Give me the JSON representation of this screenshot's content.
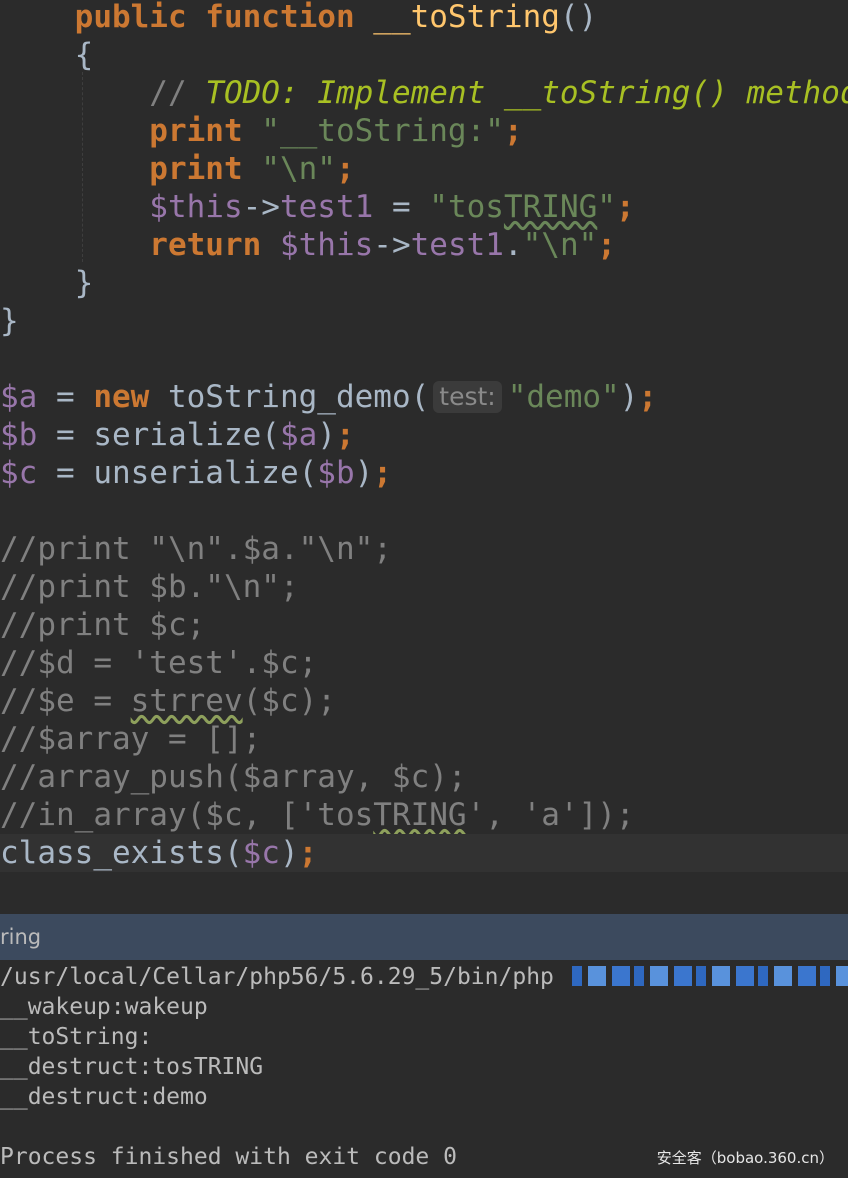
{
  "editor": {
    "lines": [
      {
        "segs": [
          [
            "kw",
            "    public function "
          ],
          [
            "fn",
            "__toString"
          ],
          [
            "op",
            "()"
          ]
        ]
      },
      {
        "segs": [
          [
            "op",
            "    {"
          ]
        ]
      },
      {
        "segs": [
          [
            "cm",
            "        // "
          ],
          [
            "todo",
            "TODO: Implement __toString() method"
          ]
        ]
      },
      {
        "segs": [
          [
            "kw",
            "        print "
          ],
          [
            "str",
            "\"__toString:\""
          ],
          [
            "kw",
            ";"
          ]
        ]
      },
      {
        "segs": [
          [
            "kw",
            "        print "
          ],
          [
            "str",
            "\"\\n\""
          ],
          [
            "kw",
            ";"
          ]
        ]
      },
      {
        "segs": [
          [
            "var",
            "        $this"
          ],
          [
            "op",
            "->"
          ],
          [
            "var",
            "test1"
          ],
          [
            "op",
            " = "
          ],
          [
            "str",
            "\"tos"
          ],
          [
            "typo",
            "TRING"
          ],
          [
            "str",
            "\""
          ],
          [
            "kw",
            ";"
          ]
        ]
      },
      {
        "segs": [
          [
            "kw",
            "        return "
          ],
          [
            "var",
            "$this"
          ],
          [
            "op",
            "->"
          ],
          [
            "var",
            "test1"
          ],
          [
            "op",
            "."
          ],
          [
            "str",
            "\"\\n\""
          ],
          [
            "kw",
            ";"
          ]
        ]
      },
      {
        "segs": [
          [
            "op",
            "    }"
          ]
        ]
      },
      {
        "segs": [
          [
            "op",
            "}"
          ]
        ]
      },
      {
        "segs": [
          [
            "op",
            ""
          ]
        ]
      },
      {
        "segs": [
          [
            "var",
            "$a"
          ],
          [
            "op",
            " = "
          ],
          [
            "kw",
            "new "
          ],
          [
            "op",
            "toString_demo("
          ],
          [
            "hint",
            "test:"
          ],
          [
            "str",
            "\"demo\""
          ],
          [
            "op",
            ")"
          ],
          [
            "kw",
            ";"
          ]
        ]
      },
      {
        "segs": [
          [
            "var",
            "$b"
          ],
          [
            "op",
            " = serialize("
          ],
          [
            "var",
            "$a"
          ],
          [
            "op",
            ")"
          ],
          [
            "kw",
            ";"
          ]
        ]
      },
      {
        "segs": [
          [
            "var",
            "$c"
          ],
          [
            "op",
            " = unserialize("
          ],
          [
            "var",
            "$b"
          ],
          [
            "op",
            ")"
          ],
          [
            "kw",
            ";"
          ]
        ]
      },
      {
        "segs": [
          [
            "op",
            ""
          ]
        ]
      },
      {
        "segs": [
          [
            "cm",
            "//print \"\\n\".$a.\"\\n\";"
          ]
        ]
      },
      {
        "segs": [
          [
            "cm",
            "//print $b.\"\\n\";"
          ]
        ]
      },
      {
        "segs": [
          [
            "cm",
            "//print $c;"
          ]
        ]
      },
      {
        "segs": [
          [
            "cm",
            "//$d = 'test'.$c;"
          ]
        ]
      },
      {
        "segs": [
          [
            "cm",
            "//$e = "
          ],
          [
            "typo2c",
            "strrev"
          ],
          [
            "cm",
            "($c);"
          ]
        ]
      },
      {
        "segs": [
          [
            "cm",
            "//$array = [];"
          ]
        ]
      },
      {
        "segs": [
          [
            "cm",
            "//array_push($array, $c);"
          ]
        ]
      },
      {
        "segs": [
          [
            "cm",
            "//in_array($c, ['tos"
          ],
          [
            "typo2c",
            "TRING"
          ],
          [
            "cm",
            "', 'a']);"
          ]
        ]
      },
      {
        "segs": [
          [
            "op",
            "class_exists("
          ],
          [
            "var",
            "$c"
          ],
          [
            "op",
            ")"
          ],
          [
            "kw",
            ";"
          ]
        ],
        "current": true
      }
    ]
  },
  "run_panel": {
    "tab_label": "ring",
    "output": [
      "/usr/local/Cellar/php56/5.6.29_5/bin/php",
      "__wakeup:wakeup",
      "__toString:",
      "__destruct:tosTRING",
      "__destruct:demo",
      "",
      "Process finished with exit code 0"
    ]
  },
  "watermark": "安全客（bobao.360.cn）",
  "colors": {
    "keyword": "#cc7832",
    "function": "#ffc66d",
    "string": "#6a8759",
    "variable": "#9876aa",
    "comment": "#808080",
    "todo": "#a8c023",
    "background": "#2b2b2b",
    "run_header": "#3c4a5e"
  }
}
